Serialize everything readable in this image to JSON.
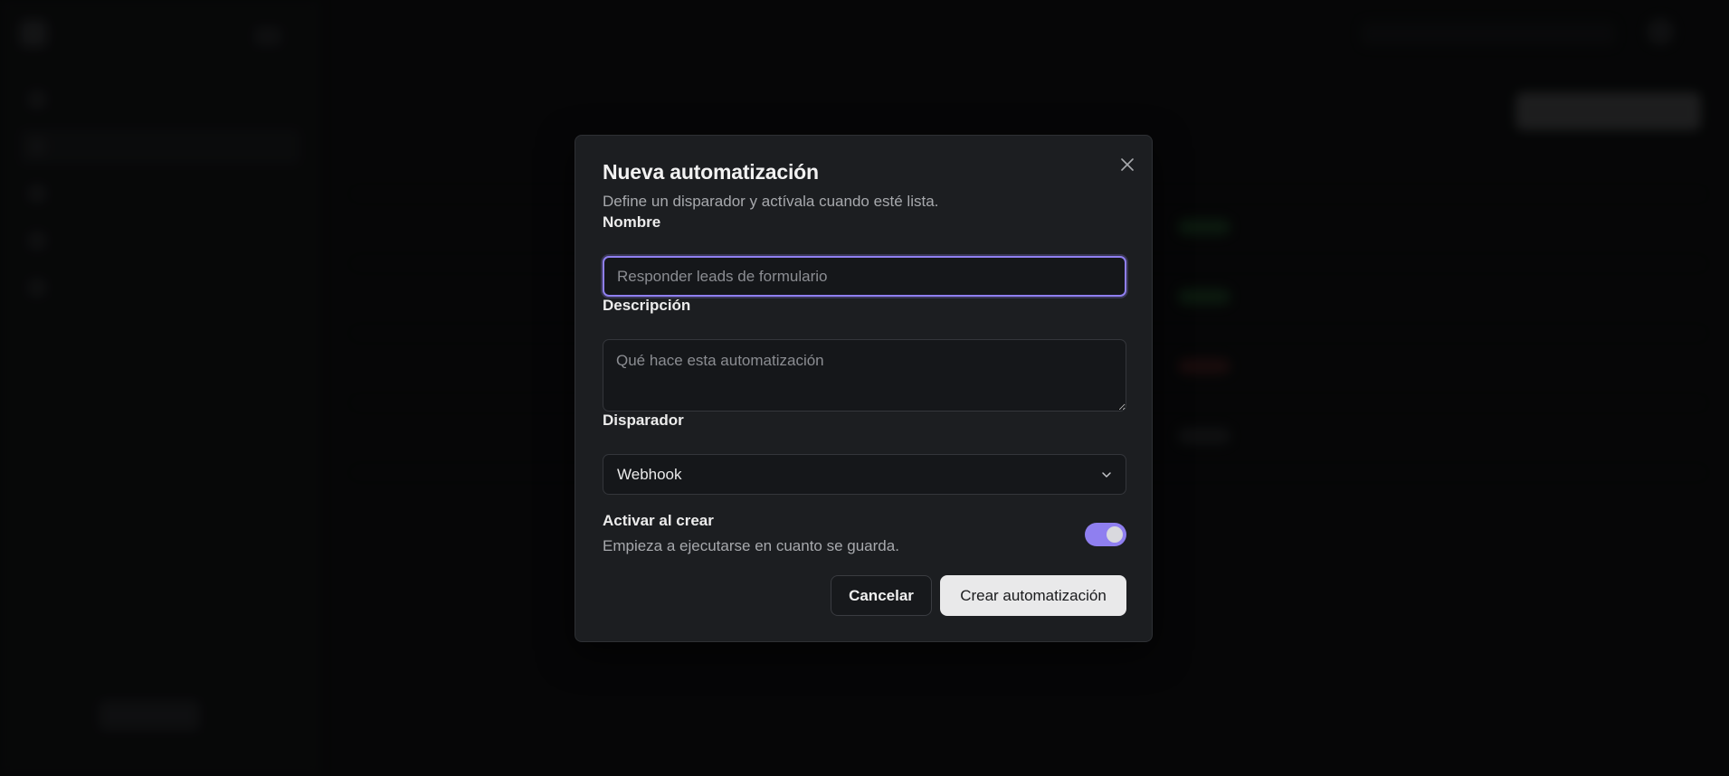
{
  "modal": {
    "title": "Nueva automatización",
    "description": "Define un disparador y actívala cuando esté lista.",
    "name_label": "Nombre",
    "name_placeholder": "Responder leads de formulario",
    "name_value": "",
    "description_label": "Descripción",
    "description_placeholder": "Qué hace esta automatización",
    "description_value": "",
    "trigger_label": "Disparador",
    "trigger_value": "Webhook",
    "activate_title": "Activar al crear",
    "activate_description": "Empieza a ejecutarse en cuanto se guarda.",
    "activate_on": true,
    "cancel_label": "Cancelar",
    "create_label": "Crear automatización"
  },
  "icons": {
    "close": "close-icon",
    "chevron": "chevron-down-icon"
  },
  "colors": {
    "accent": "#8f7ff0",
    "modal_bg": "#1c1e21",
    "primary_button": "#e9e9ea",
    "status_active": "#2f8f3e",
    "status_error": "#8f2a2a"
  }
}
